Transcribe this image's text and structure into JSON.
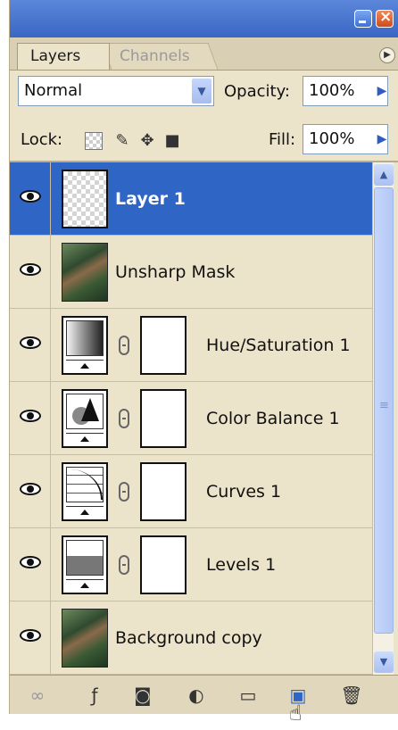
{
  "tabs": {
    "layers": "Layers",
    "channels": "Channels"
  },
  "blend": {
    "mode": "Normal",
    "opacity_label": "Opacity:",
    "opacity_value": "100%"
  },
  "lock": {
    "label": "Lock:",
    "fill_label": "Fill:",
    "fill_value": "100%"
  },
  "layers": [
    {
      "name": "Layer 1",
      "selected": true,
      "thumb": "transparent"
    },
    {
      "name": "Unsharp Mask",
      "selected": false,
      "thumb": "photo"
    },
    {
      "name": "Hue/Saturation 1",
      "selected": false,
      "thumb": "adjustment-gradient"
    },
    {
      "name": "Color Balance 1",
      "selected": false,
      "thumb": "adjustment-color-balance"
    },
    {
      "name": "Curves 1",
      "selected": false,
      "thumb": "adjustment-curves"
    },
    {
      "name": "Levels 1",
      "selected": false,
      "thumb": "adjustment-levels"
    },
    {
      "name": "Background copy",
      "selected": false,
      "thumb": "photo"
    }
  ],
  "icons": {
    "link": "link-layers-icon",
    "fx": "layer-style-icon",
    "mask": "add-mask-icon",
    "adjustment": "adjustment-layer-icon",
    "group": "new-group-icon",
    "new_layer": "new-layer-icon",
    "delete": "trash-icon",
    "cursor": "hand-pointer-icon"
  },
  "colors": {
    "selection": "#2f66c5",
    "panel_bg": "#ece3cb",
    "titlebar": "#3a67c4"
  }
}
